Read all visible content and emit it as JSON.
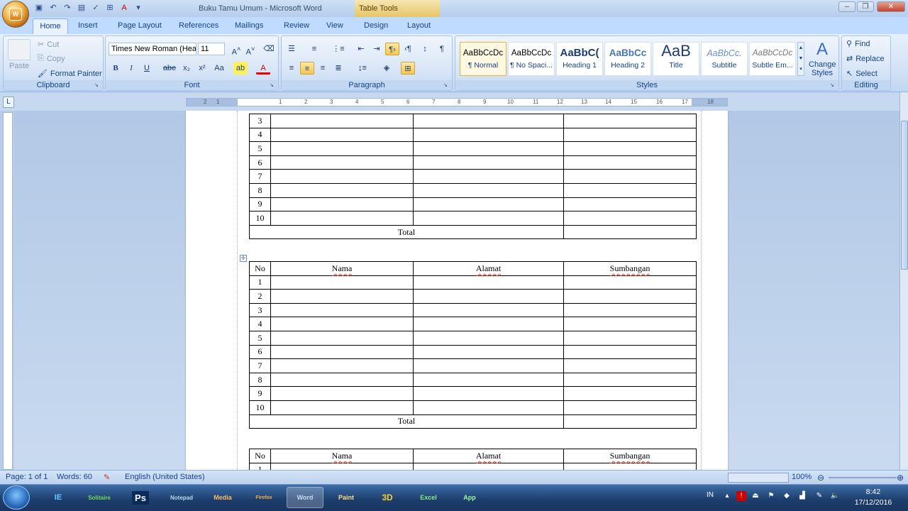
{
  "window": {
    "title": "Buku Tamu Umum - Microsoft Word",
    "contextual_tab_group": "Table Tools"
  },
  "tabs": [
    "Home",
    "Insert",
    "Page Layout",
    "References",
    "Mailings",
    "Review",
    "View",
    "Design",
    "Layout"
  ],
  "clipboard": {
    "paste": "Paste",
    "cut": "Cut",
    "copy": "Copy",
    "format_painter": "Format Painter",
    "label": "Clipboard"
  },
  "font": {
    "name": "Times New Roman (Hea",
    "size": "11",
    "label": "Font"
  },
  "paragraph": {
    "label": "Paragraph"
  },
  "styles": {
    "label": "Styles",
    "items": [
      {
        "preview": "AaBbCcDc",
        "name": "¶ Normal"
      },
      {
        "preview": "AaBbCcDc",
        "name": "¶ No Spaci..."
      },
      {
        "preview": "AaBbC(",
        "name": "Heading 1"
      },
      {
        "preview": "AaBbCc",
        "name": "Heading 2"
      },
      {
        "preview": "AaB",
        "name": "Title"
      },
      {
        "preview": "AaBbCc.",
        "name": "Subtitle"
      },
      {
        "preview": "AaBbCcDc",
        "name": "Subtle Em..."
      }
    ],
    "change_styles": "Change Styles"
  },
  "editing": {
    "find": "Find",
    "replace": "Replace",
    "select": "Select",
    "label": "Editing"
  },
  "ruler": {
    "ticks": [
      "2",
      "1",
      "1",
      "2",
      "3",
      "4",
      "5",
      "6",
      "7",
      "8",
      "9",
      "10",
      "11",
      "12",
      "13",
      "14",
      "15",
      "16",
      "17",
      "18"
    ]
  },
  "document": {
    "headers": {
      "no": "No",
      "nama": "Nama",
      "alamat": "Alamat",
      "sumbangan": "Sumbangan"
    },
    "total_label": "Total",
    "table1_rows": [
      "3",
      "4",
      "5",
      "6",
      "7",
      "8",
      "9",
      "10"
    ],
    "table2_rows": [
      "1",
      "2",
      "3",
      "4",
      "5",
      "6",
      "7",
      "8",
      "9",
      "10"
    ],
    "table3_rows": [
      "1"
    ]
  },
  "status": {
    "page": "Page: 1 of 1",
    "words": "Words: 60",
    "language": "English (United States)",
    "zoom": "100%"
  },
  "taskbar": {
    "items": [
      "IE",
      "Solitaire",
      "Ps",
      "Notepad",
      "Media",
      "Firefox",
      "Word",
      "Paint",
      "3D",
      "Excel",
      "App"
    ],
    "language": "IN"
  },
  "clock": {
    "time": "8:42",
    "date": "17/12/2016"
  }
}
